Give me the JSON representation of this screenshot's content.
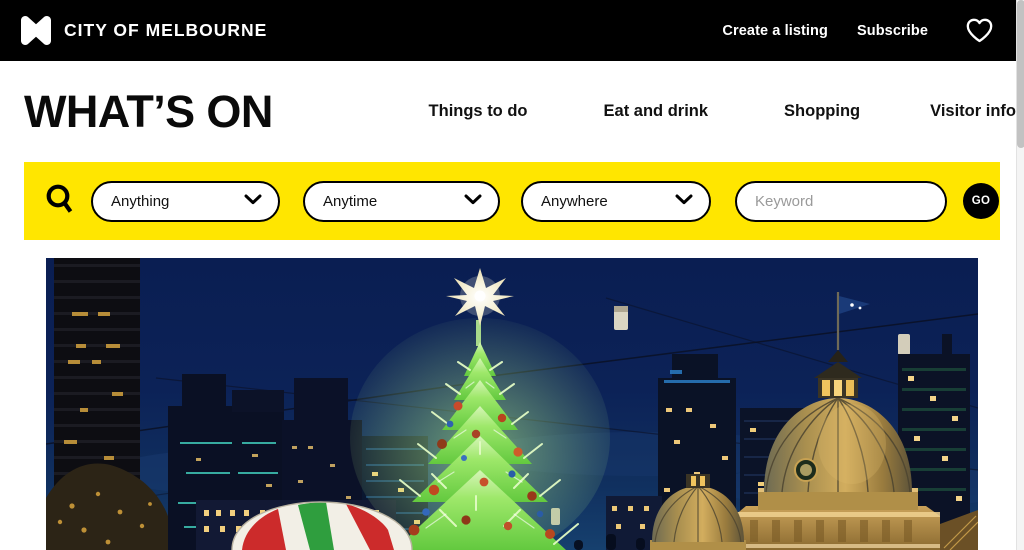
{
  "brand": {
    "logo_icon": "melbourne-m-logo",
    "name": "CITY OF MELBOURNE"
  },
  "topnav": {
    "create_listing": "Create a listing",
    "subscribe": "Subscribe",
    "favourites_icon": "heart-outline-icon"
  },
  "header": {
    "title": "WHAT’S ON"
  },
  "mainnav": {
    "items": [
      {
        "label": "Things to do"
      },
      {
        "label": "Eat and drink"
      },
      {
        "label": "Shopping"
      },
      {
        "label": "Visitor info"
      }
    ]
  },
  "search": {
    "search_icon": "magnifying-glass-icon",
    "category": {
      "value": "Anything",
      "chevron_icon": "chevron-down-icon"
    },
    "date": {
      "value": "Anytime",
      "chevron_icon": "chevron-down-icon"
    },
    "location": {
      "value": "Anywhere",
      "chevron_icon": "chevron-down-icon"
    },
    "keyword": {
      "value": "",
      "placeholder": "Keyword"
    },
    "submit_label": "GO",
    "band_color": "#ffe600"
  },
  "hero": {
    "alt": "Illuminated green Christmas tree in front of Melbourne city skyline at dusk with Flinders Street Station dome",
    "sky_color": "#0b1f4d",
    "tree_color": "#8ce05a",
    "dome_color": "#c8922f"
  }
}
